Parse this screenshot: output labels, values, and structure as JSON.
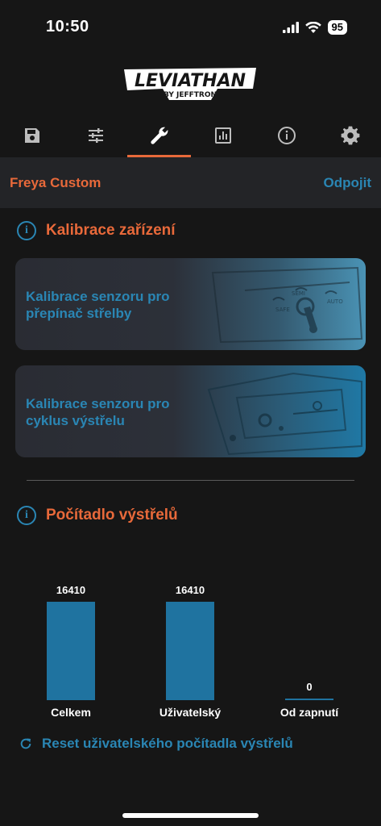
{
  "status": {
    "time": "10:50",
    "battery": "95"
  },
  "logo": {
    "main": "LEVIATHAN",
    "sub": "BY JEFFTRON"
  },
  "tabs": [
    {
      "icon": "save-icon"
    },
    {
      "icon": "sliders-icon"
    },
    {
      "icon": "wrench-icon",
      "active": true
    },
    {
      "icon": "chart-icon"
    },
    {
      "icon": "info-icon"
    },
    {
      "icon": "gear-icon"
    }
  ],
  "device": {
    "name": "Freya Custom",
    "disconnect": "Odpojit"
  },
  "calibration": {
    "title": "Kalibrace zařízení",
    "cards": [
      {
        "label": "Kalibrace senzoru pro přepínač střelby",
        "art_labels": [
          "SAFE",
          "SEMI",
          "AUTO"
        ]
      },
      {
        "label": "Kalibrace senzoru pro cyklus výstřelu"
      }
    ]
  },
  "counter": {
    "title": "Počítadlo výstřelů",
    "reset_label": "Reset uživatelského počítadla výstřelů"
  },
  "chart_data": {
    "type": "bar",
    "categories": [
      "Celkem",
      "Uživatelský",
      "Od zapnutí"
    ],
    "values": [
      16410,
      16410,
      0
    ],
    "value_labels": [
      "16410",
      "16410",
      "0"
    ],
    "ylim": [
      0,
      16410
    ],
    "color": "#1f73a0"
  },
  "colors": {
    "accent": "#e8693a",
    "link": "#2a86b4",
    "background": "#161616"
  }
}
